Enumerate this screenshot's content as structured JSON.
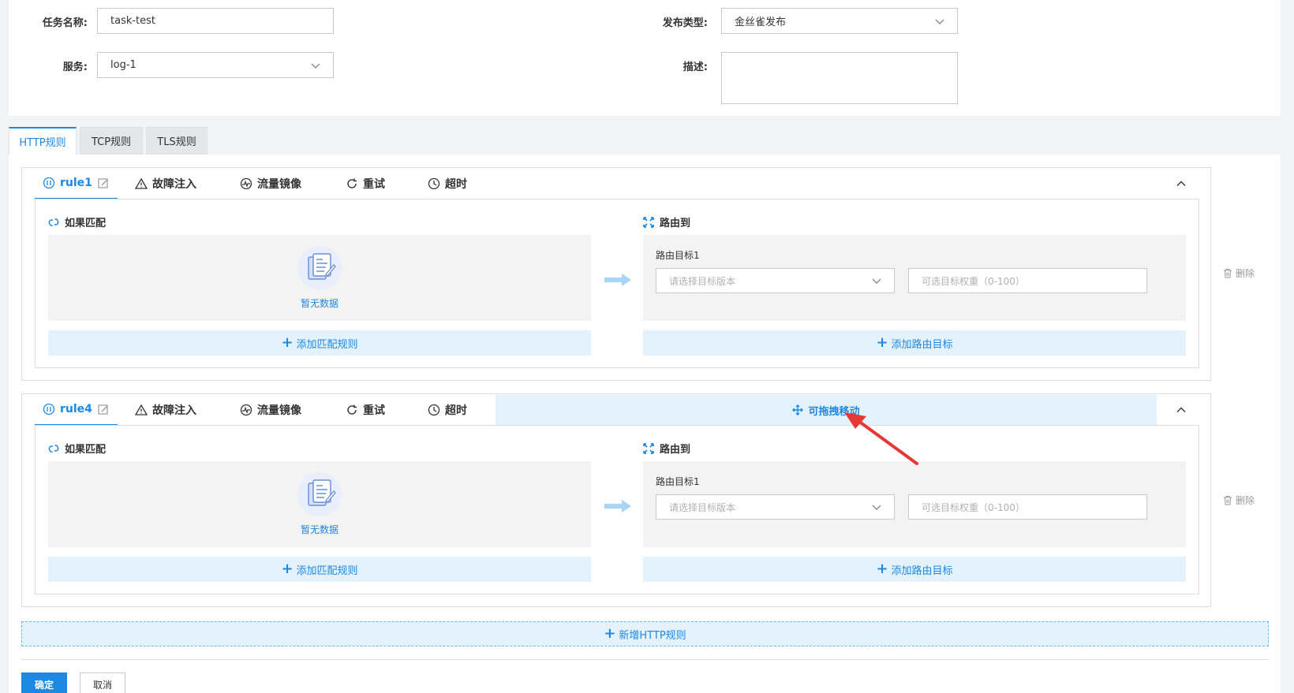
{
  "form": {
    "task_name_label": "任务名称:",
    "task_name_value": "task-test",
    "service_label": "服务:",
    "service_value": "log-1",
    "release_type_label": "发布类型:",
    "release_type_value": "金丝雀发布",
    "description_label": "描述:",
    "description_value": ""
  },
  "tabs": [
    {
      "label": "HTTP规则",
      "active": true
    },
    {
      "label": "TCP规则",
      "active": false
    },
    {
      "label": "TLS规则",
      "active": false
    }
  ],
  "rule_nav": {
    "fault_injection": "故障注入",
    "traffic_mirror": "流量镜像",
    "retry": "重试",
    "timeout": "超时"
  },
  "rules": [
    {
      "name": "rule1",
      "match_title": "如果匹配",
      "route_title": "路由到",
      "empty_text": "暂无数据",
      "add_match": "添加匹配规则",
      "route_target_label": "路由目标1",
      "version_placeholder": "请选择目标版本",
      "weight_placeholder": "可选目标权重（0-100）",
      "add_route": "添加路由目标",
      "delete": "删除"
    },
    {
      "name": "rule4",
      "drag_hint": "可拖拽移动",
      "match_title": "如果匹配",
      "route_title": "路由到",
      "empty_text": "暂无数据",
      "add_match": "添加匹配规则",
      "route_target_label": "路由目标1",
      "version_placeholder": "请选择目标版本",
      "weight_placeholder": "可选目标权重（0-100）",
      "add_route": "添加路由目标",
      "delete": "删除"
    }
  ],
  "new_http_rule": "新增HTTP规则",
  "buttons": {
    "ok": "确定",
    "cancel": "取消"
  },
  "colors": {
    "accent": "#1e88e5",
    "light_accent": "#e3f2fd",
    "annotation": "#e53935"
  }
}
